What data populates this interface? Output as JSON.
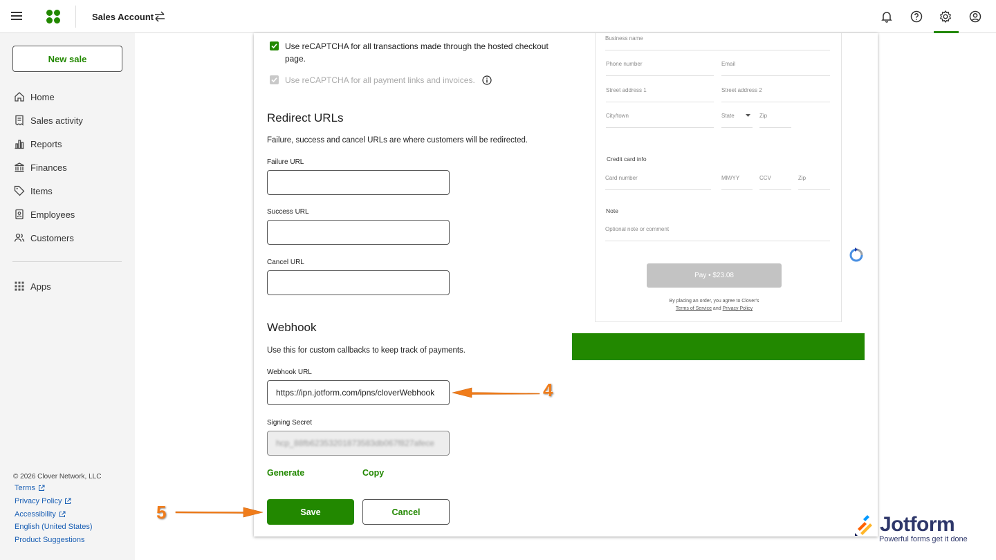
{
  "topbar": {
    "account_name": "Sales Account"
  },
  "sidebar": {
    "new_sale": "New sale",
    "items": [
      {
        "label": "Home",
        "icon": "home-icon"
      },
      {
        "label": "Sales activity",
        "icon": "receipt-icon"
      },
      {
        "label": "Reports",
        "icon": "bar-chart-icon"
      },
      {
        "label": "Finances",
        "icon": "bank-icon"
      },
      {
        "label": "Items",
        "icon": "tag-icon"
      },
      {
        "label": "Employees",
        "icon": "badge-icon"
      },
      {
        "label": "Customers",
        "icon": "people-icon"
      },
      {
        "label": "Apps",
        "icon": "grid-icon"
      }
    ],
    "footer": {
      "copyright": "© 2026 Clover Network, LLC",
      "terms": "Terms",
      "privacy": "Privacy Policy",
      "accessibility": "Accessibility",
      "language": "English (United States)",
      "suggestions": "Product Suggestions"
    }
  },
  "settings": {
    "recaptcha_hosted": "Use reCAPTCHA for all transactions made through the hosted checkout page.",
    "recaptcha_links": "Use reCAPTCHA for all payment links and invoices.",
    "redirect": {
      "title": "Redirect URLs",
      "description": "Failure, success and cancel URLs are where customers will be redirected.",
      "failure_label": "Failure URL",
      "failure_value": "",
      "success_label": "Success URL",
      "success_value": "",
      "cancel_label": "Cancel URL",
      "cancel_value": ""
    },
    "webhook": {
      "title": "Webhook",
      "description": "Use this for custom callbacks to keep track of payments.",
      "url_label": "Webhook URL",
      "url_value": "https://ipn.jotform.com/ipns/cloverWebhook",
      "secret_label": "Signing Secret",
      "secret_value": "hcp_88fb62353201873583db067f827afece",
      "generate": "Generate",
      "copy": "Copy"
    },
    "save": "Save",
    "cancel": "Cancel"
  },
  "preview": {
    "business_name": "Business name",
    "phone": "Phone number",
    "email": "Email",
    "street1": "Street address 1",
    "street2": "Street address 2",
    "city": "City/town",
    "state": "State",
    "zip": "Zip",
    "card_info": "Credit card info",
    "card_number": "Card number",
    "expiry": "MM/YY",
    "ccv": "CCV",
    "card_zip": "Zip",
    "note": "Note",
    "note_placeholder": "Optional note or comment",
    "pay_button": "Pay • $23.08",
    "terms_line1": "By placing an order, you agree to Clover's",
    "terms_of_service": "Terms of Service",
    "and": "and",
    "privacy_policy": "Privacy Policy"
  },
  "annotations": {
    "step4": "4",
    "step5": "5",
    "arrow_color": "#f07c1a"
  },
  "watermark": {
    "name": "Jotform",
    "tagline": "Powerful forms get it done"
  },
  "colors": {
    "brand_green": "#228800",
    "link_blue": "#1a5fb4"
  }
}
